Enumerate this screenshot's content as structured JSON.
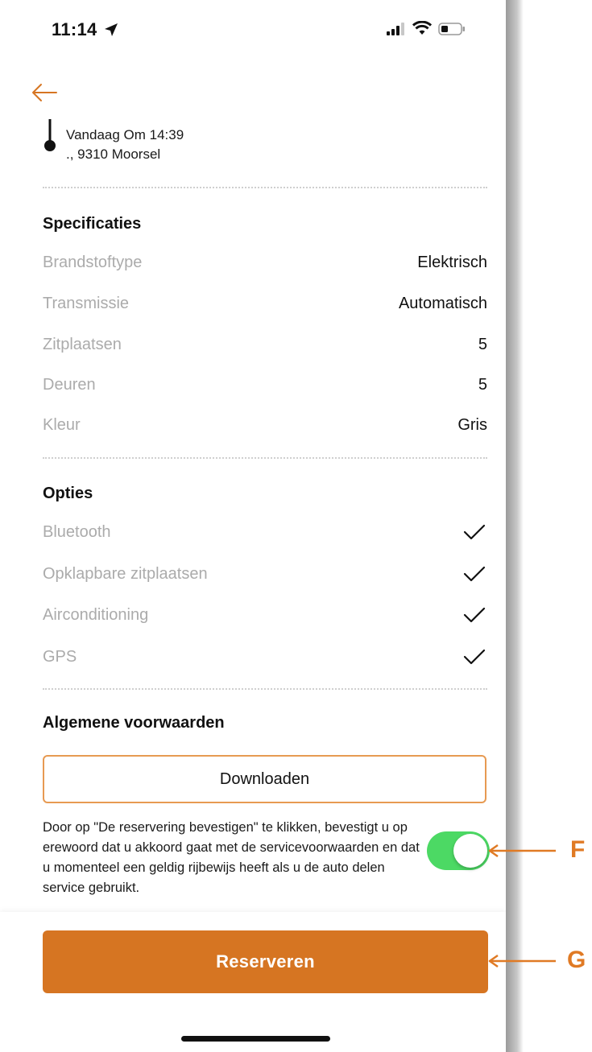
{
  "status_bar": {
    "time": "11:14"
  },
  "header": {
    "back_icon": "arrow-left-icon"
  },
  "location": {
    "line1": "Vandaag Om 14:39",
    "line2": "., 9310 Moorsel"
  },
  "specs": {
    "title": "Specificaties",
    "rows": [
      {
        "label": "Brandstoftype",
        "value": "Elektrisch"
      },
      {
        "label": "Transmissie",
        "value": "Automatisch"
      },
      {
        "label": "Zitplaatsen",
        "value": "5"
      },
      {
        "label": "Deuren",
        "value": "5"
      },
      {
        "label": "Kleur",
        "value": "Gris"
      }
    ]
  },
  "options": {
    "title": "Opties",
    "items": [
      {
        "label": "Bluetooth",
        "checked": true
      },
      {
        "label": "Opklapbare zitplaatsen",
        "checked": true
      },
      {
        "label": "Airconditioning",
        "checked": true
      },
      {
        "label": "GPS",
        "checked": true
      }
    ]
  },
  "terms": {
    "title": "Algemene voorwaarden",
    "download_label": "Downloaden",
    "consent_text": "Door op \"De reservering bevestigen\" te klikken, bevestigt u op erewoord dat u akkoord gaat met de servicevoorwaarden en dat u momenteel een geldig rijbewijs heeft als u de auto delen service gebruikt.",
    "toggle_on": true
  },
  "footer": {
    "reserve_label": "Reserveren"
  },
  "annotations": {
    "f": "F",
    "g": "G"
  },
  "colors": {
    "accent": "#d67522",
    "toggle_on": "#4cd964",
    "muted_text": "#ababab",
    "annotation": "#e07a24"
  }
}
